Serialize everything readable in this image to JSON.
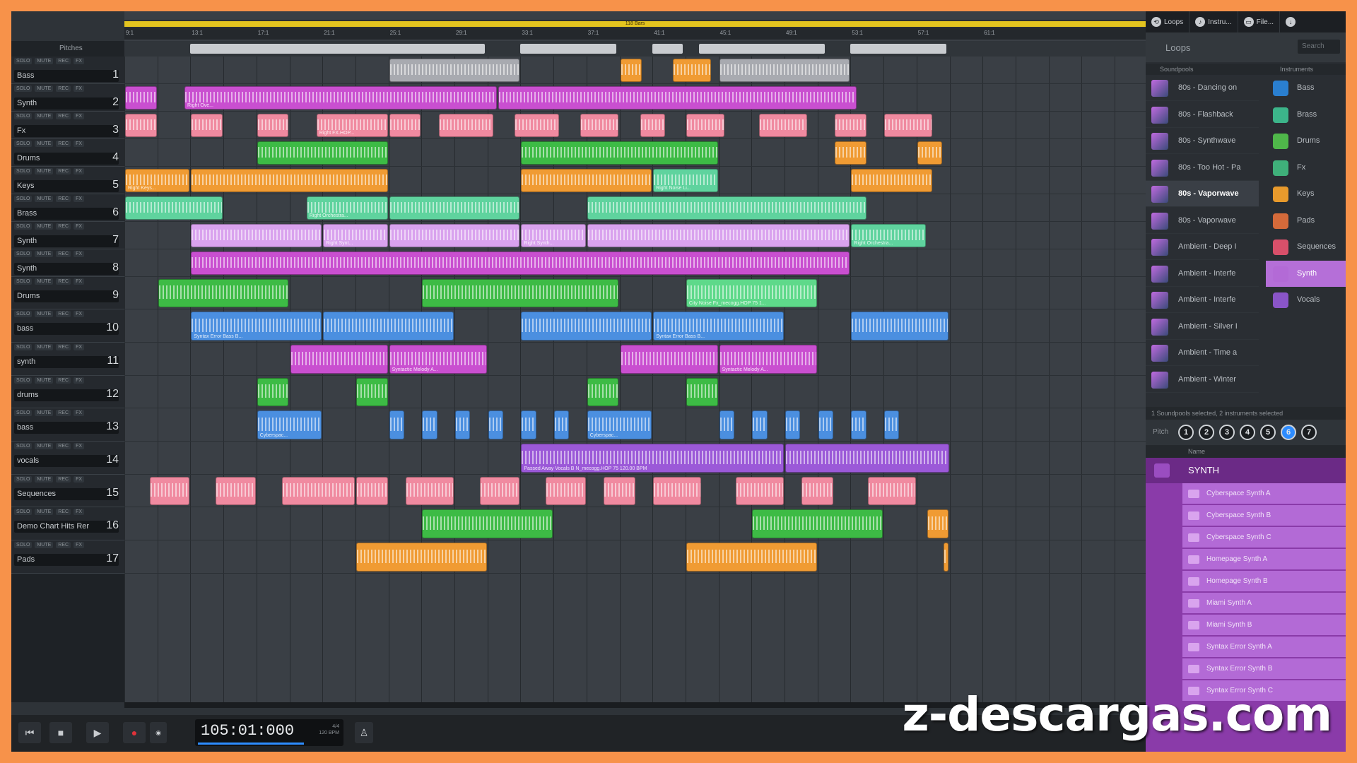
{
  "colors": {
    "frame": "#f7924a",
    "bg": "#2e3338",
    "loop": "#e3c41f",
    "accent": "#2d8cff",
    "synth_purple": "#b36ad6"
  },
  "header": {
    "pitches_label": "Pitches",
    "loop_region_label": "118 Bars"
  },
  "tracks": [
    {
      "name": "Bass",
      "num": "1",
      "solo": "SOLO",
      "mute": "MUTE",
      "rec": "REC",
      "fx": "FX"
    },
    {
      "name": "Synth",
      "num": "2",
      "solo": "SOLO",
      "mute": "MUTE",
      "rec": "REC",
      "fx": "FX"
    },
    {
      "name": "Fx",
      "num": "3",
      "solo": "SOLO",
      "mute": "MUTE",
      "rec": "REC",
      "fx": "FX"
    },
    {
      "name": "Drums",
      "num": "4",
      "solo": "SOLO",
      "mute": "MUTE",
      "rec": "REC",
      "fx": "FX"
    },
    {
      "name": "Keys",
      "num": "5",
      "solo": "SOLO",
      "mute": "MUTE",
      "rec": "REC",
      "fx": "FX"
    },
    {
      "name": "Brass",
      "num": "6",
      "solo": "SOLO",
      "mute": "MUTE",
      "rec": "REC",
      "fx": "FX"
    },
    {
      "name": "Synth",
      "num": "7",
      "solo": "SOLO",
      "mute": "MUTE",
      "rec": "REC",
      "fx": "FX"
    },
    {
      "name": "Synth",
      "num": "8",
      "solo": "SOLO",
      "mute": "MUTE",
      "rec": "REC",
      "fx": "FX"
    },
    {
      "name": "Drums",
      "num": "9",
      "solo": "SOLO",
      "mute": "MUTE",
      "rec": "REC",
      "fx": "FX"
    },
    {
      "name": "bass",
      "num": "10",
      "solo": "SOLO",
      "mute": "MUTE",
      "rec": "REC",
      "fx": "FX"
    },
    {
      "name": "synth",
      "num": "11",
      "solo": "SOLO",
      "mute": "MUTE",
      "rec": "REC",
      "fx": "FX"
    },
    {
      "name": "drums",
      "num": "12",
      "solo": "SOLO",
      "mute": "MUTE",
      "rec": "REC",
      "fx": "FX"
    },
    {
      "name": "bass",
      "num": "13",
      "solo": "SOLO",
      "mute": "MUTE",
      "rec": "REC",
      "fx": "FX"
    },
    {
      "name": "vocals",
      "num": "14",
      "solo": "SOLO",
      "mute": "MUTE",
      "rec": "REC",
      "fx": "FX"
    },
    {
      "name": "Sequences",
      "num": "15",
      "solo": "SOLO",
      "mute": "MUTE",
      "rec": "REC",
      "fx": "FX"
    },
    {
      "name": "Demo Chart Hits Rer",
      "num": "16",
      "solo": "SOLO",
      "mute": "MUTE",
      "rec": "REC",
      "fx": "FX"
    },
    {
      "name": "Pads",
      "num": "17",
      "solo": "SOLO",
      "mute": "MUTE",
      "rec": "REC",
      "fx": "FX"
    }
  ],
  "ruler_ticks": [
    "9:1",
    "13:1",
    "17:1",
    "21:1",
    "25:1",
    "29:1",
    "33:1",
    "37:1",
    "41:1",
    "45:1",
    "49:1",
    "53:1",
    "57:1",
    "61:1"
  ],
  "clip_labels": [
    "Right Ove...",
    "Right FX.HOP...",
    "Right Keys...",
    "Right Orchestra...",
    "Right Orche...",
    "Right Synt...",
    "Right Synth...",
    "City Noise Fx_mecogg.HOP  75  1...",
    "Syntax Error Bass B...",
    "Syntax Error Bass B...",
    "Syntactic Melody A...",
    "Syntactic Melody A...",
    "Cyberspac...",
    "Cyberspac...",
    "Passed Away Vocals B N_mecogg.HOP  75  120.00 BPM",
    "Right Noise Li...",
    "Right Orchestra..."
  ],
  "transport": {
    "time": "105:01:000",
    "tempo": "120 BPM",
    "signature": "4/4",
    "rew_icon": "rewind-icon",
    "stop_icon": "stop-icon",
    "play_icon": "play-icon",
    "rec_icon": "record-icon"
  },
  "right": {
    "tabs": [
      {
        "label": "Loops",
        "icon": "loop-icon"
      },
      {
        "label": "Instru...",
        "icon": "instrument-icon"
      },
      {
        "label": "File...",
        "icon": "folder-icon"
      }
    ],
    "loops_title": "Loops",
    "search_placeholder": "Search",
    "col_soundpools": "Soundpools",
    "col_instruments": "Instruments",
    "soundpools": [
      "80s - Dancing on",
      "80s - Flashback",
      "80s - Synthwave",
      "80s - Too Hot - Pa",
      "80s - Vaporwave",
      "80s - Vaporwave",
      "Ambient - Deep I",
      "Ambient - Interfe",
      "Ambient - Interfe",
      "Ambient - Silver I",
      "Ambient - Time a",
      "Ambient - Winter"
    ],
    "instruments": [
      {
        "name": "Bass",
        "color": "#2a7fd0"
      },
      {
        "name": "Brass",
        "color": "#3cb58a"
      },
      {
        "name": "Drums",
        "color": "#4fb84a"
      },
      {
        "name": "Fx",
        "color": "#3fb07a"
      },
      {
        "name": "Keys",
        "color": "#e89a2c"
      },
      {
        "name": "Pads",
        "color": "#d46a3a"
      },
      {
        "name": "Sequences",
        "color": "#d8506a"
      },
      {
        "name": "Synth",
        "color": "#b36ad6"
      },
      {
        "name": "Vocals",
        "color": "#8a55c8"
      }
    ],
    "status": "1 Soundpools selected, 2 instruments selected",
    "pitch_label": "Pitch",
    "pitch_numbers": [
      "1",
      "2",
      "3",
      "4",
      "5",
      "6",
      "7"
    ],
    "name_header": "Name",
    "category": "SYNTH",
    "synth_items": [
      "Cyberspace Synth A",
      "Cyberspace Synth B",
      "Cyberspace Synth C",
      "Homepage Synth A",
      "Homepage Synth B",
      "Miami Synth A",
      "Miami Synth B",
      "Syntax Error Synth A",
      "Syntax Error Synth B",
      "Syntax Error Synth C"
    ]
  },
  "watermark": "z-descargas.com"
}
